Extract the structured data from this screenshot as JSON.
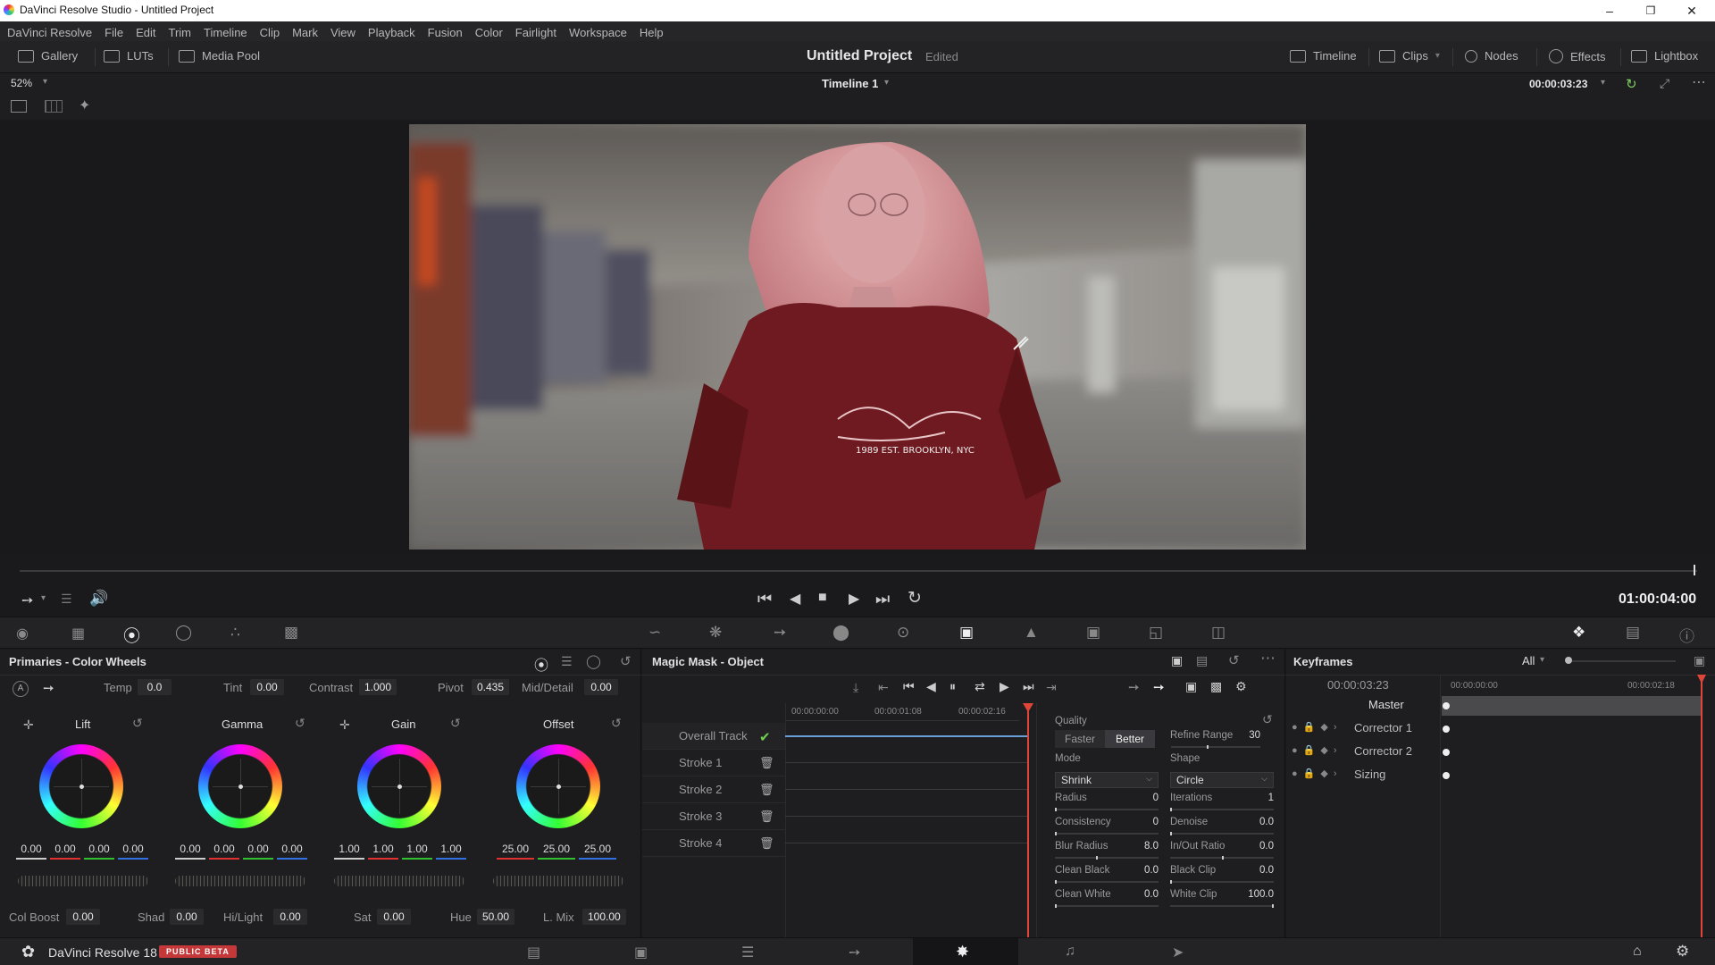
{
  "window": {
    "title": "DaVinci Resolve Studio - Untitled Project"
  },
  "menu": [
    "DaVinci Resolve",
    "File",
    "Edit",
    "Trim",
    "Timeline",
    "Clip",
    "Mark",
    "View",
    "Playback",
    "Fusion",
    "Color",
    "Fairlight",
    "Workspace",
    "Help"
  ],
  "toolbar": {
    "gallery": "Gallery",
    "luts": "LUTs",
    "media_pool": "Media Pool",
    "project_title": "Untitled Project",
    "project_status": "Edited",
    "timeline": "Timeline",
    "clips": "Clips",
    "nodes": "Nodes",
    "effects": "Effects",
    "lightbox": "Lightbox"
  },
  "viewer": {
    "zoom": "52%",
    "timeline_name": "Timeline 1",
    "timecode": "00:00:03:23",
    "shirt_text": "1989 EST. BROOKLYN, NYC"
  },
  "transport": {
    "timecode": "01:00:04:00"
  },
  "primaries": {
    "title": "Primaries - Color Wheels",
    "temp_label": "Temp",
    "temp": "0.0",
    "tint_label": "Tint",
    "tint": "0.00",
    "contrast_label": "Contrast",
    "contrast": "1.000",
    "pivot_label": "Pivot",
    "pivot": "0.435",
    "middetail_label": "Mid/Detail",
    "middetail": "0.00",
    "wheels": [
      {
        "name": "Lift",
        "values": [
          "0.00",
          "0.00",
          "0.00",
          "0.00"
        ]
      },
      {
        "name": "Gamma",
        "values": [
          "0.00",
          "0.00",
          "0.00",
          "0.00"
        ]
      },
      {
        "name": "Gain",
        "values": [
          "1.00",
          "1.00",
          "1.00",
          "1.00"
        ]
      },
      {
        "name": "Offset",
        "values": [
          "25.00",
          "25.00",
          "25.00"
        ]
      }
    ],
    "colboost_label": "Col Boost",
    "colboost": "0.00",
    "shad_label": "Shad",
    "shad": "0.00",
    "hilight_label": "Hi/Light",
    "hilight": "0.00",
    "sat_label": "Sat",
    "sat": "0.00",
    "hue_label": "Hue",
    "hue": "50.00",
    "lmix_label": "L. Mix",
    "lmix": "100.00"
  },
  "magic_mask": {
    "title": "Magic Mask - Object",
    "ruler": [
      "00:00:00:00",
      "00:00:01:08",
      "00:00:02:16"
    ],
    "tracks": [
      "Overall Track",
      "Stroke 1",
      "Stroke 2",
      "Stroke 3",
      "Stroke 4"
    ],
    "quality_label": "Quality",
    "faster": "Faster",
    "better": "Better",
    "refine_range_label": "Refine Range",
    "refine_range": "30",
    "mode_label": "Mode",
    "mode": "Shrink",
    "shape_label": "Shape",
    "shape": "Circle",
    "radius_label": "Radius",
    "radius": "0",
    "iterations_label": "Iterations",
    "iterations": "1",
    "consistency_label": "Consistency",
    "consistency": "0",
    "denoise_label": "Denoise",
    "denoise": "0.0",
    "blur_radius_label": "Blur Radius",
    "blur_radius": "8.0",
    "inout_ratio_label": "In/Out Ratio",
    "inout_ratio": "0.0",
    "clean_black_label": "Clean Black",
    "clean_black": "0.0",
    "black_clip_label": "Black Clip",
    "black_clip": "0.0",
    "clean_white_label": "Clean White",
    "clean_white": "0.0",
    "white_clip_label": "White Clip",
    "white_clip": "100.0"
  },
  "keyframes": {
    "title": "Keyframes",
    "filter": "All",
    "timecode": "00:00:03:23",
    "ruler": [
      "00:00:00:00",
      "00:00:02:18"
    ],
    "rows": [
      "Master",
      "Corrector 1",
      "Corrector 2",
      "Sizing"
    ]
  },
  "bottom": {
    "app_name": "DaVinci Resolve 18",
    "badge": "PUBLIC BETA"
  },
  "colors": {
    "accent_red": "#e0453a",
    "beta_badge": "#c4383a",
    "mask_tint": "#8b1a20"
  }
}
